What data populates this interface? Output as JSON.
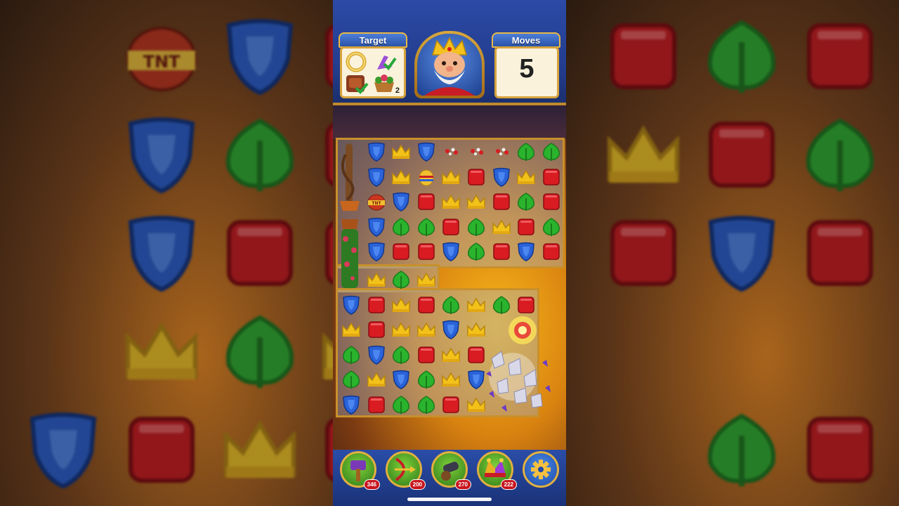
{
  "hud": {
    "target_label": "Target",
    "moves_label": "Moves",
    "moves_value": "5",
    "target_items": [
      {
        "icon": "gold-ring-icon",
        "done": false
      },
      {
        "icon": "purple-dart-icon",
        "done": true
      },
      {
        "icon": "wooden-peg-icon",
        "done": true
      },
      {
        "icon": "flower-basket-icon",
        "count": "2"
      }
    ]
  },
  "boosters": [
    {
      "name": "hammer-booster",
      "count": "346"
    },
    {
      "name": "arrow-booster",
      "count": "200"
    },
    {
      "name": "cannon-booster",
      "count": "270"
    },
    {
      "name": "jester-hat-booster",
      "count": "222"
    },
    {
      "name": "settings-gear",
      "count": ""
    }
  ],
  "colors": {
    "blue": "#2a62d8",
    "red": "#d81c22",
    "yellow": "#f3c21a",
    "green": "#2ab32c",
    "frame": "#c8902c",
    "booster_green": "#4fa82a"
  },
  "board": {
    "rows": [
      [
        "vine",
        "B",
        "Y",
        "B",
        "R?",
        "R?",
        "R?",
        "G",
        "G"
      ],
      [
        "vine",
        "B",
        "Y",
        "L",
        "Y",
        "R",
        "B",
        "Y",
        "R"
      ],
      [
        "vine",
        "T",
        "B",
        "R",
        "Y",
        "Y",
        "R",
        "G",
        "R"
      ],
      [
        "vine",
        "B",
        "G",
        "G",
        "R",
        "G",
        "Y",
        "R",
        "G"
      ],
      [
        "vine",
        "B",
        "R",
        "R",
        "B",
        "G",
        "R",
        "B",
        "R"
      ],
      [
        "",
        "Y",
        "G",
        "Y",
        "",
        "",
        "",
        "",
        ""
      ],
      [
        "B",
        "R",
        "Y",
        "R",
        "G",
        "Y",
        "G",
        "R",
        ""
      ],
      [
        "Y",
        "R",
        "Y",
        "Y",
        "B",
        "Y",
        "X",
        "X",
        ""
      ],
      [
        "G",
        "B",
        "G",
        "R",
        "Y",
        "R",
        "X",
        "X",
        ""
      ],
      [
        "G",
        "Y",
        "B",
        "G",
        "Y",
        "B",
        "X",
        "X",
        ""
      ],
      [
        "B",
        "R",
        "G",
        "G",
        "R",
        "Y",
        "X",
        "X",
        ""
      ]
    ]
  }
}
